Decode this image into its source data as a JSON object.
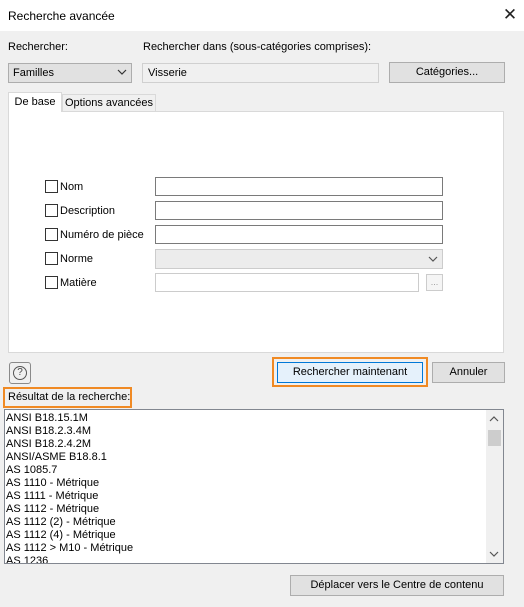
{
  "window": {
    "title": "Recherche avancée"
  },
  "search_in": {
    "label": "Rechercher:",
    "selected": "Familles",
    "scope_label": "Rechercher dans (sous-catégories comprises):",
    "scope_value": "Visserie",
    "categories_button": "Catégories..."
  },
  "tabs": [
    {
      "label": "De base",
      "active": true
    },
    {
      "label": "Options avancées",
      "active": false
    }
  ],
  "fields": {
    "nom": "Nom",
    "description": "Description",
    "numero": "Numéro de pièce",
    "norme": "Norme",
    "matiere": "Matière",
    "browse": "..."
  },
  "actions": {
    "search_now": "Rechercher maintenant",
    "cancel": "Annuler",
    "help": "?"
  },
  "results": {
    "label": "Résultat de la recherche:",
    "items": [
      "ANSI B18.15.1M",
      "ANSI B18.2.3.4M",
      "ANSI B18.2.4.2M",
      "ANSI/ASME B18.8.1",
      "AS 1085.7",
      "AS 1110 - Métrique",
      "AS 1111 - Métrique",
      "AS 1112 - Métrique",
      "AS 1112 (2) - Métrique",
      "AS 1112 (4) - Métrique",
      "AS 1112 > M10 - Métrique",
      "AS 1236"
    ]
  },
  "footer": {
    "move_button": "Déplacer vers le Centre de contenu"
  },
  "colors": {
    "highlight": "#f08a24",
    "focus_border": "#0078d7"
  }
}
